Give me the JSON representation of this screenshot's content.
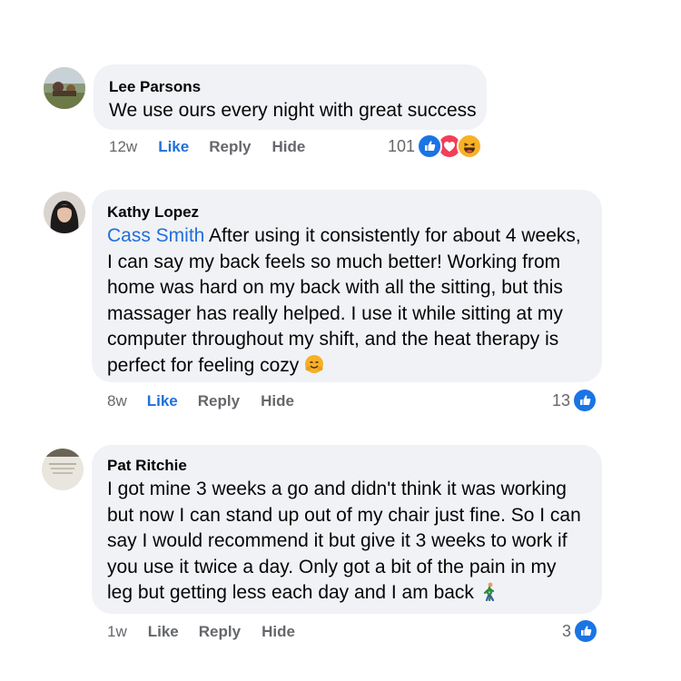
{
  "comments": [
    {
      "author": "Lee Parsons",
      "text": "We use ours every night with great success",
      "time": "12w",
      "like_label": "Like",
      "reply_label": "Reply",
      "hide_label": "Hide",
      "reaction_count": "101",
      "reactions": [
        "like-icon",
        "love-icon",
        "haha-icon"
      ],
      "liked": true
    },
    {
      "author": "Kathy Lopez",
      "mention": "Cass Smith",
      "text_lines": [
        " After using it consistently for about 4 weeks,",
        "I can say my back feels so much better! Working from",
        "home was hard on my back with all the sitting, but this",
        "massager has really helped. I use it while sitting at my",
        "computer throughout my shift, and the heat therapy is",
        "perfect for feeling cozy "
      ],
      "emoji": "hugging-face-emoji",
      "time": "8w",
      "like_label": "Like",
      "reply_label": "Reply",
      "hide_label": "Hide",
      "reaction_count": "13",
      "reactions": [
        "like-icon"
      ],
      "liked": true
    },
    {
      "author": "Pat Ritchie",
      "text_lines": [
        "I got mine 3 weeks a go and didn't think it was working",
        "but now I can stand up out of my chair just fine. So I can",
        "say I would recommend it but give it 3 weeks to work if",
        "you use it twice a day. Only got a bit of the pain in my",
        "leg but getting less each day and I am back "
      ],
      "emoji": "person-walking-emoji",
      "time": "1w",
      "like_label": "Like",
      "reply_label": "Reply",
      "hide_label": "Hide",
      "reaction_count": "3",
      "reactions": [
        "like-icon"
      ],
      "liked": false
    }
  ],
  "colors": {
    "bubble": "#f0f2f5",
    "link": "#216fdb",
    "meta": "#65676b",
    "like_blue": "#1b74e4",
    "love_red": "#f33e58",
    "haha_yellow": "#f7b125"
  }
}
